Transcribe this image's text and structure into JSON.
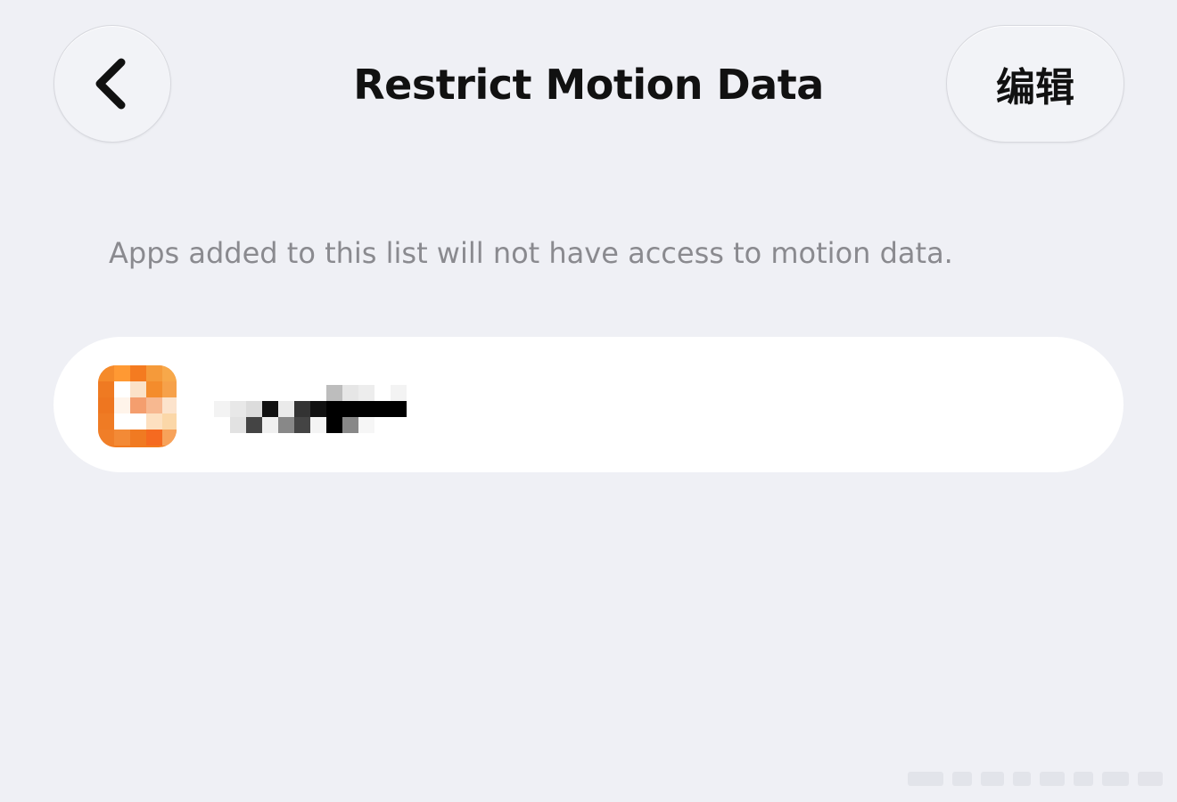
{
  "header": {
    "back_icon": "chevron-left-icon",
    "title": "Restrict Motion Data",
    "edit_label": "编辑"
  },
  "description": "Apps added to this list will not have access to motion data.",
  "apps": [
    {
      "icon": "orange-app-icon",
      "name_redacted": true
    }
  ],
  "colors": {
    "background": "#eff0f5",
    "card": "#ffffff",
    "title": "#111111",
    "secondary_text": "#8a8a8f",
    "app_accent": "#f27a1e"
  }
}
